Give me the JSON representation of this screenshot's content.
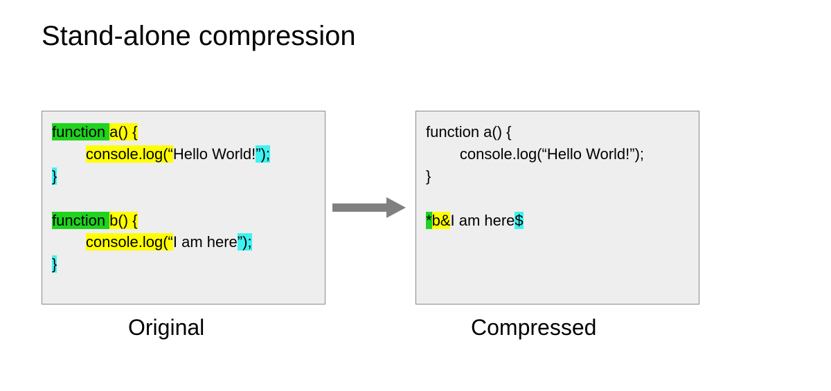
{
  "title": "Stand-alone compression",
  "captions": {
    "left": "Original",
    "right": "Compressed"
  },
  "colors": {
    "green": "#1fd31f",
    "yellow": "#ffff00",
    "cyan": "#3ff1f1"
  },
  "original": {
    "fn1": {
      "kw": "function ",
      "sig": "a() {",
      "indent": "        ",
      "call": "console.log(“",
      "arg": "Hello World!",
      "tail": "”);",
      "close": "}"
    },
    "fn2": {
      "kw": "function ",
      "sig": "b() {",
      "indent": "        ",
      "call": "console.log(“",
      "arg": "I am here",
      "tail": "”);",
      "close": "}"
    }
  },
  "compressed": {
    "fn1": {
      "line1": "function a() {",
      "line2": "        console.log(“Hello World!”);",
      "line3": "}"
    },
    "fn2": {
      "star": "*",
      "mid": "b&",
      "arg": "I am here",
      "end": "$"
    }
  }
}
